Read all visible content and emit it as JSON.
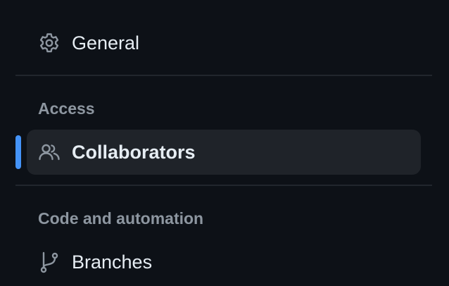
{
  "nav": {
    "general": {
      "label": "General",
      "icon": "gear-icon"
    },
    "sections": [
      {
        "heading": "Access",
        "items": [
          {
            "label": "Collaborators",
            "icon": "people-icon",
            "active": true
          }
        ]
      },
      {
        "heading": "Code and automation",
        "items": [
          {
            "label": "Branches",
            "icon": "git-branch-icon",
            "active": false
          }
        ]
      }
    ]
  },
  "colors": {
    "background": "#0d1117",
    "active_background": "#1f2329",
    "active_indicator": "#4493f8",
    "text": "#e6edf3",
    "muted_text": "#8d96a0",
    "divider": "#21262d"
  }
}
